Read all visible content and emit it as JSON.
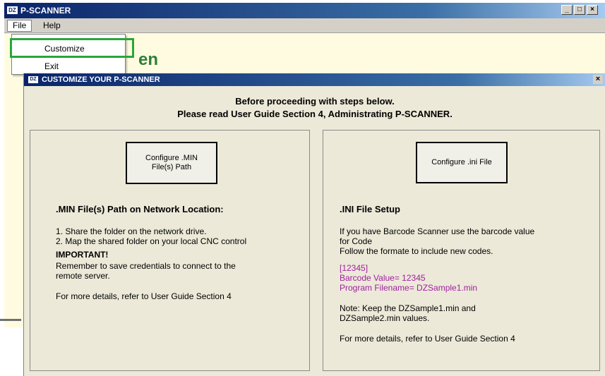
{
  "app": {
    "logo_text": "DZ",
    "title": "P-SCANNER",
    "window_controls": [
      "_",
      "□",
      "×"
    ]
  },
  "menubar": {
    "file_label": "File",
    "help_label": "Help"
  },
  "file_menu": {
    "items": [
      "Customize",
      "Exit"
    ],
    "highlighted_item": "Customize"
  },
  "background": {
    "heading_fragment": "en"
  },
  "dialog": {
    "logo_text": "DZ",
    "title": "CUSTOMIZE YOUR P-SCANNER",
    "close_label": "×",
    "intro_line1": "Before proceeding with steps below.",
    "intro_line2": "Please read User Guide Section 4, Administrating P-SCANNER.",
    "left_panel": {
      "button_line1": "Configure .MIN",
      "button_line2": "File(s) Path",
      "heading": ".MIN File(s) Path on Network Location:",
      "step1": "1. Share the folder on the network drive.",
      "step2": "2. Map the shared folder on your local CNC control",
      "important_label": "IMPORTANT!",
      "important_line1": "Remember to save credentials to connect to the",
      "important_line2": "remote server.",
      "more_details": "For more details, refer to User Guide Section 4"
    },
    "right_panel": {
      "button_label": "Configure .ini File",
      "heading": ".INI File Setup",
      "text_line1": "If you have Barcode Scanner use the barcode value",
      "text_line2": "for Code",
      "text_line3": "Follow the formate to include new codes.",
      "example_line1": "[12345]",
      "example_line2": "Barcode Value= 12345",
      "example_line3": "Program Filename= DZSample1.min",
      "note_line1": "Note: Keep the DZSample1.min and",
      "note_line2": "DZSample2.min values.",
      "more_details": "For more details, refer to User Guide Section 4"
    }
  },
  "colors": {
    "title_bar": "#0a246a",
    "highlight_box": "#29a63a",
    "example_text": "#a020a0",
    "background_heading": "#2d7f3a"
  }
}
